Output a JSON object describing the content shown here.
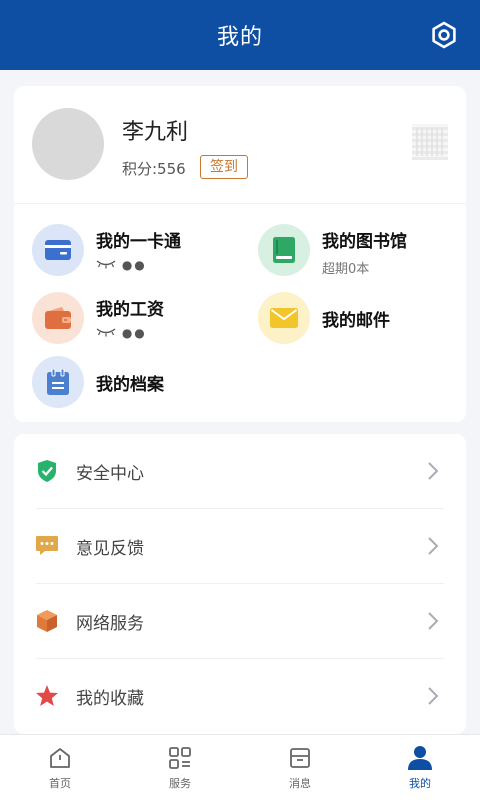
{
  "header": {
    "title": "我的",
    "settings_icon": "settings-gear-icon"
  },
  "profile": {
    "name": "李九利",
    "points_text": "积分:556",
    "signin_label": "签到"
  },
  "functions": [
    {
      "title": "我的一卡通",
      "sub": "●●",
      "icon": "card-icon",
      "color": "#3d6fd0"
    },
    {
      "title": "我的图书馆",
      "sub": "超期0本",
      "icon": "book-icon",
      "color": "#2fa865"
    },
    {
      "title": "我的工资",
      "sub": "●●",
      "icon": "wallet-icon",
      "color": "#e06f3f"
    },
    {
      "title": "我的邮件",
      "sub": "",
      "icon": "mail-icon",
      "color": "#f2c52b"
    },
    {
      "title": "我的档案",
      "sub": "",
      "icon": "clipboard-icon",
      "color": "#4d7fcf"
    }
  ],
  "menu": [
    {
      "label": "安全中心",
      "icon": "shield-icon",
      "color": "#27b36b"
    },
    {
      "label": "意见反馈",
      "icon": "chat-bubble-icon",
      "color": "#e0a84a"
    },
    {
      "label": "网络服务",
      "icon": "cube-icon",
      "color": "#e07a3a"
    },
    {
      "label": "我的收藏",
      "icon": "star-icon",
      "color": "#e24a4a"
    }
  ],
  "bottom_nav": [
    {
      "label": "首页",
      "icon": "home-icon"
    },
    {
      "label": "服务",
      "icon": "grid-icon"
    },
    {
      "label": "消息",
      "icon": "inbox-icon"
    },
    {
      "label": "我的",
      "icon": "user-icon",
      "active": true
    }
  ],
  "colors": {
    "brand": "#0e4fa3",
    "accent": "#c9772e"
  }
}
